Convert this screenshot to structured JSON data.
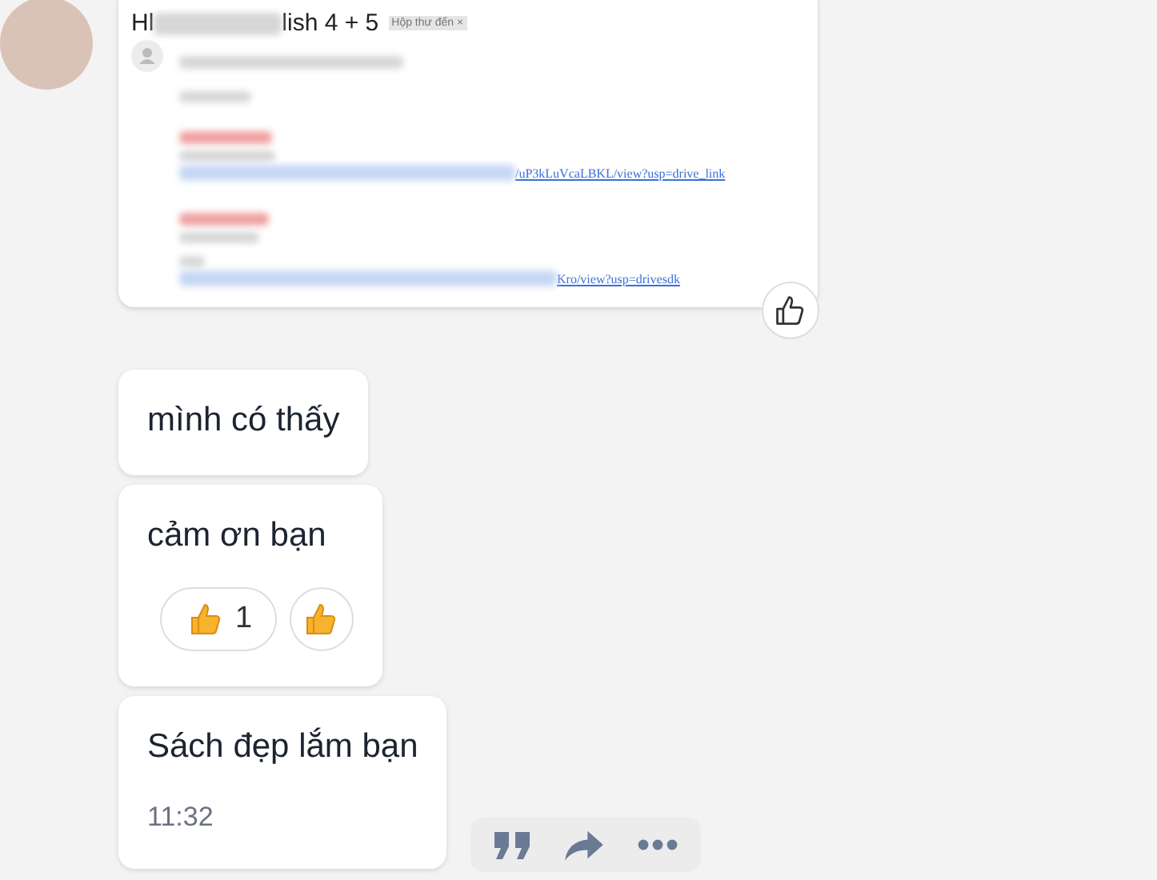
{
  "email_card": {
    "title_start": "Hl",
    "subject": "lish 4 + 5",
    "tag": "Hộp thư đến ×",
    "links": [
      "/uP3kLuVcaLBKL/view?usp=drive_link",
      "Kro/view?usp=drivesdk"
    ]
  },
  "messages": [
    {
      "text": "mình có thấy"
    },
    {
      "text": "cảm ơn bạn",
      "reaction_count": "1"
    },
    {
      "text": "Sách đẹp lắm bạn",
      "time": "11:32"
    }
  ]
}
